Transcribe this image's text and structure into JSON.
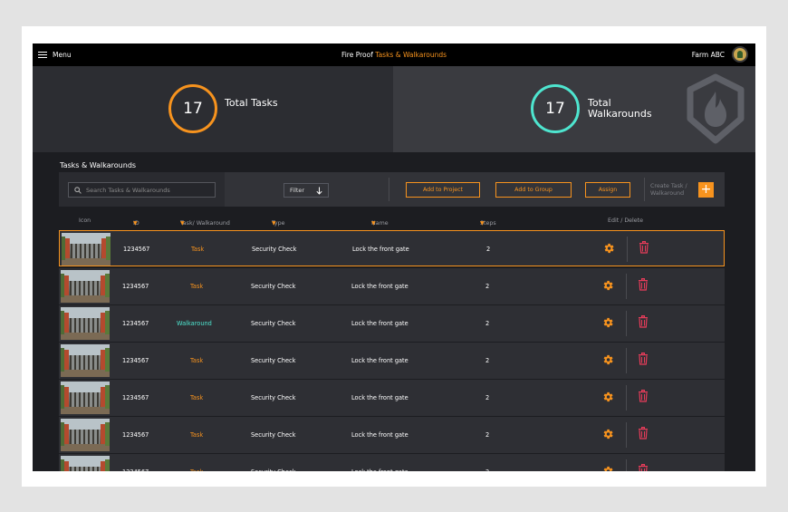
{
  "topbar": {
    "menu_label": "Menu",
    "title_prefix": "Fire Proof",
    "title_accent": "Tasks & Walkarounds",
    "farm_name": "Farm ABC"
  },
  "stats": {
    "tasks": {
      "count": "17",
      "label": "Total Tasks",
      "color": "#f7931e"
    },
    "walkarounds": {
      "count": "17",
      "label": "Total Walkarounds",
      "color": "#4ee5cf"
    }
  },
  "section": {
    "title": "Tasks & Walkarounds"
  },
  "toolbar": {
    "search_placeholder": "Search Tasks & Walkarounds",
    "filter_label": "Filter",
    "add_project_label": "Add to Project",
    "add_group_label": "Add to Group",
    "assign_label": "Assign",
    "create_label": "Create Task / Walkaround",
    "plus_label": "+"
  },
  "table": {
    "columns": {
      "icon": "Icon",
      "id": "ID",
      "task": "Task/ Walkaround",
      "type": "Type",
      "name": "Name",
      "steps": "Steps",
      "edit": "Edit / Delete"
    },
    "rows": [
      {
        "id": "1234567",
        "kind": "Task",
        "type": "Security Check",
        "name": "Lock the front gate",
        "steps": "2"
      },
      {
        "id": "1234567",
        "kind": "Task",
        "type": "Security Check",
        "name": "Lock the front gate",
        "steps": "2"
      },
      {
        "id": "1234567",
        "kind": "Walkaround",
        "type": "Security Check",
        "name": "Lock the front gate",
        "steps": "2"
      },
      {
        "id": "1234567",
        "kind": "Task",
        "type": "Security Check",
        "name": "Lock the front gate",
        "steps": "2"
      },
      {
        "id": "1234567",
        "kind": "Task",
        "type": "Security Check",
        "name": "Lock the front gate",
        "steps": "2"
      },
      {
        "id": "1234567",
        "kind": "Task",
        "type": "Security Check",
        "name": "Lock the front gate",
        "steps": "2"
      }
    ]
  },
  "colors": {
    "accent": "#f7931e",
    "teal": "#4ee5cf",
    "delete": "#e83c5a"
  }
}
